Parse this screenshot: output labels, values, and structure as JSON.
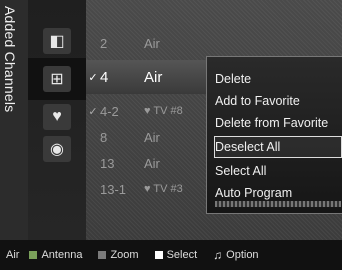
{
  "vertical_title": "Added Channels",
  "channels": [
    {
      "check": "",
      "num": "2",
      "name": "Air",
      "fav": ""
    },
    {
      "check": "✓",
      "num": "4",
      "name": "Air",
      "fav": ""
    },
    {
      "check": "✓",
      "num": "4-2",
      "name": "",
      "fav": "♥ TV #8"
    },
    {
      "check": "",
      "num": "8",
      "name": "Air",
      "fav": ""
    },
    {
      "check": "",
      "num": "13",
      "name": "Air",
      "fav": ""
    },
    {
      "check": "",
      "num": "13-1",
      "name": "",
      "fav": "♥ TV #3"
    }
  ],
  "row_partial_text": "Ai",
  "menu": {
    "items": [
      "Delete",
      "Add to Favorite",
      "Delete from Favorite",
      "Deselect All",
      "Select All",
      "Auto Program"
    ],
    "selected": "Deselect All"
  },
  "icons": [
    "all-icon",
    "added-channels-icon",
    "favorite-icon",
    "program-icon"
  ],
  "bottom": {
    "air": "Air",
    "antenna": "Antenna",
    "zoom": "Zoom",
    "select": "Select",
    "option": "Option"
  },
  "colors": {
    "antenna_key": "#7aa05a",
    "zoom_key": "#7b7b7b",
    "select_key": "#ffffff"
  }
}
